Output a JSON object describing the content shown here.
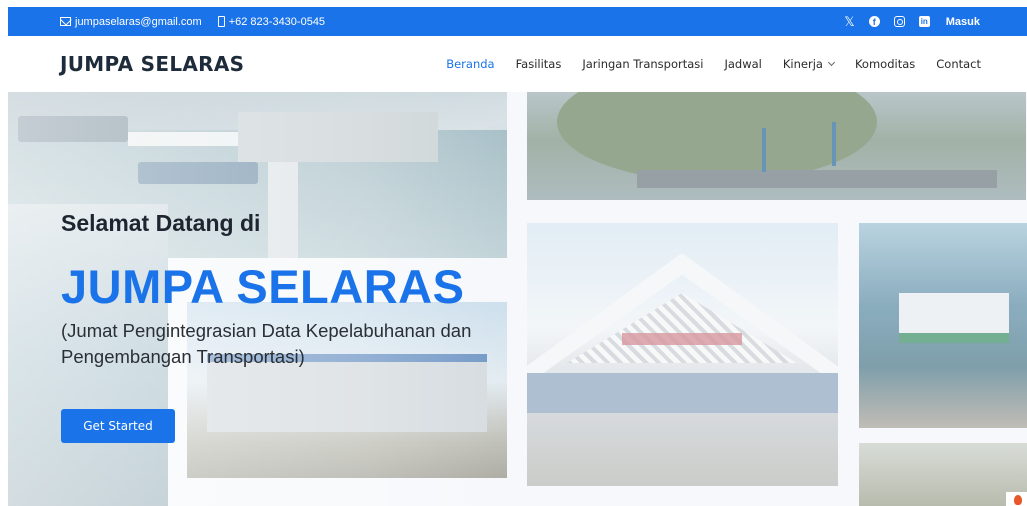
{
  "topbar": {
    "email": "jumpaselaras@gmail.com",
    "phone": "+62 823-3430-0545",
    "social": {
      "x": "𝕏",
      "facebook": "f",
      "linkedin": "in"
    },
    "login_label": "Masuk"
  },
  "header": {
    "logo": "JUMPA SELARAS",
    "nav": [
      {
        "label": "Beranda",
        "active": true
      },
      {
        "label": "Fasilitas"
      },
      {
        "label": "Jaringan Transportasi"
      },
      {
        "label": "Jadwal"
      },
      {
        "label": "Kinerja"
      },
      {
        "label": "Komoditas"
      },
      {
        "label": "Contact"
      }
    ]
  },
  "hero": {
    "welcome": "Selamat Datang di",
    "brand": "JUMPA SELARAS",
    "tagline": "(Jumat Pengintegrasian Data Kepelabuhanan dan Pengembangan Transportasi)",
    "cta_label": "Get Started"
  },
  "colors": {
    "primary": "#1a73e8",
    "text_dark": "#1d2b3a"
  },
  "icons": {
    "email": "mail-icon",
    "phone": "phone-icon",
    "x": "x-icon",
    "facebook": "facebook-icon",
    "instagram": "instagram-icon",
    "linkedin": "linkedin-icon",
    "dropdown": "chevron-down-icon"
  }
}
